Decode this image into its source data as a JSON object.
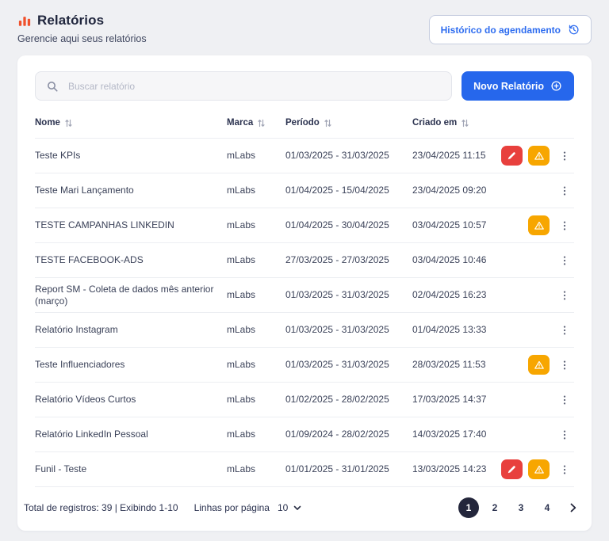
{
  "header": {
    "title": "Relatórios",
    "subtitle": "Gerencie aqui seus relatórios",
    "history_button_label": "Histórico do agendamento"
  },
  "toolbar": {
    "search_placeholder": "Buscar relatório",
    "new_report_label": "Novo Relatório"
  },
  "table": {
    "columns": [
      {
        "label": "Nome"
      },
      {
        "label": "Marca"
      },
      {
        "label": "Período"
      },
      {
        "label": "Criado em"
      }
    ],
    "rows": [
      {
        "nome": "Teste KPIs",
        "marca": "mLabs",
        "periodo": "01/03/2025 - 31/03/2025",
        "criado_em": "23/04/2025 11:15",
        "badges": [
          "pen",
          "warning"
        ]
      },
      {
        "nome": "Teste Mari Lançamento",
        "marca": "mLabs",
        "periodo": "01/04/2025 - 15/04/2025",
        "criado_em": "23/04/2025 09:20",
        "badges": []
      },
      {
        "nome": "TESTE CAMPANHAS LINKEDIN",
        "marca": "mLabs",
        "periodo": "01/04/2025 - 30/04/2025",
        "criado_em": "03/04/2025 10:57",
        "badges": [
          "warning"
        ]
      },
      {
        "nome": "TESTE FACEBOOK-ADS",
        "marca": "mLabs",
        "periodo": "27/03/2025 - 27/03/2025",
        "criado_em": "03/04/2025 10:46",
        "badges": []
      },
      {
        "nome": "Report SM - Coleta de dados mês anterior (março)",
        "marca": "mLabs",
        "periodo": "01/03/2025 - 31/03/2025",
        "criado_em": "02/04/2025 16:23",
        "badges": []
      },
      {
        "nome": "Relatório Instagram",
        "marca": "mLabs",
        "periodo": "01/03/2025 - 31/03/2025",
        "criado_em": "01/04/2025 13:33",
        "badges": []
      },
      {
        "nome": "Teste Influenciadores",
        "marca": "mLabs",
        "periodo": "01/03/2025 - 31/03/2025",
        "criado_em": "28/03/2025 11:53",
        "badges": [
          "warning"
        ]
      },
      {
        "nome": "Relatório Vídeos Curtos",
        "marca": "mLabs",
        "periodo": "01/02/2025 - 28/02/2025",
        "criado_em": "17/03/2025 14:37",
        "badges": []
      },
      {
        "nome": "Relatório LinkedIn Pessoal",
        "marca": "mLabs",
        "periodo": "01/09/2024 - 28/02/2025",
        "criado_em": "14/03/2025 17:40",
        "badges": []
      },
      {
        "nome": "Funil - Teste",
        "marca": "mLabs",
        "periodo": "01/01/2025 - 31/01/2025",
        "criado_em": "13/03/2025 14:23",
        "badges": [
          "pen",
          "warning"
        ]
      }
    ]
  },
  "footer": {
    "total_text": "Total de registros: 39 | Exibindo 1-10",
    "rows_per_page_label": "Linhas por página",
    "rows_per_page_value": "10",
    "pages": [
      "1",
      "2",
      "3",
      "4"
    ],
    "active_page": "1"
  },
  "colors": {
    "primary_blue": "#2667ec",
    "badge_red": "#e8403d",
    "badge_amber": "#f7a600",
    "active_page_bg": "#23263b",
    "title_icon_orange": "#f0512c"
  },
  "icons": {
    "title": "bar-chart-icon",
    "history": "history-icon",
    "search": "search-icon",
    "new_report": "plus-circle-icon",
    "sort": "sort-icon",
    "pen_badge": "pen-icon",
    "warning_badge": "warning-icon",
    "row_menu": "kebab-menu-icon",
    "rows_per_page": "chevron-down-icon",
    "next_page": "chevron-right-icon"
  }
}
